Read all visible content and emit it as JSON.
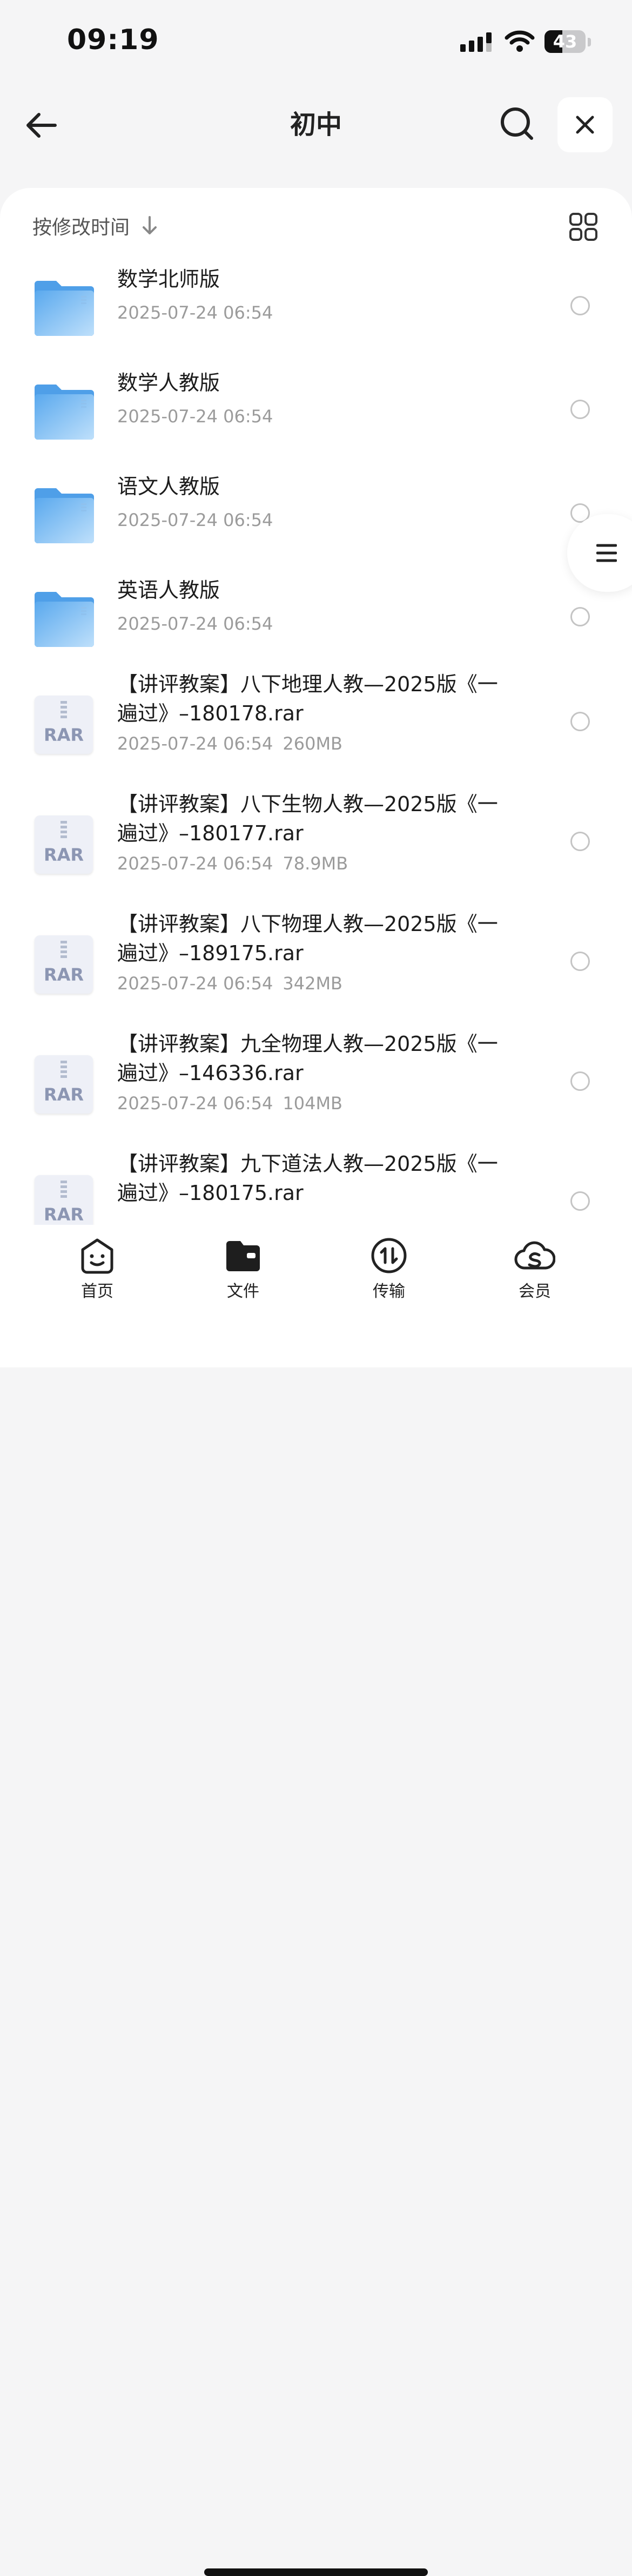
{
  "status_bar": {
    "time": "09:19",
    "battery_level": "43",
    "battery_fraction": 0.43
  },
  "header": {
    "title": "初中",
    "back_icon": "arrow-left-icon",
    "search_icon": "search-icon",
    "close_icon": "close-icon"
  },
  "sort": {
    "label": "按修改时间",
    "direction_icon": "arrow-down-icon",
    "view_toggle_icon": "grid-icon"
  },
  "files": [
    {
      "type": "folder",
      "name": "数学北师版",
      "date": "2025-07-24 06:54",
      "size": ""
    },
    {
      "type": "folder",
      "name": "数学人教版",
      "date": "2025-07-24 06:54",
      "size": ""
    },
    {
      "type": "folder",
      "name": "语文人教版",
      "date": "2025-07-24 06:54",
      "size": ""
    },
    {
      "type": "folder",
      "name": "英语人教版",
      "date": "2025-07-24 06:54",
      "size": ""
    },
    {
      "type": "rar",
      "name": "【讲评教案】八下地理人教—2025版《一遍过》–180178.rar",
      "date": "2025-07-24 06:54",
      "size": "260MB"
    },
    {
      "type": "rar",
      "name": "【讲评教案】八下生物人教—2025版《一遍过》–180177.rar",
      "date": "2025-07-24 06:54",
      "size": "78.9MB"
    },
    {
      "type": "rar",
      "name": "【讲评教案】八下物理人教—2025版《一遍过》–189175.rar",
      "date": "2025-07-24 06:54",
      "size": "342MB"
    },
    {
      "type": "rar",
      "name": "【讲评教案】九全物理人教—2025版《一遍过》–146336.rar",
      "date": "2025-07-24 06:54",
      "size": "104MB"
    },
    {
      "type": "rar",
      "name": "【讲评教案】九下道法人教—2025版《一遍过》–180175.rar",
      "date": "",
      "size": ""
    }
  ],
  "rar_label": "RAR",
  "tabs": [
    {
      "label": "首页",
      "icon": "home-face-icon"
    },
    {
      "label": "文件",
      "icon": "folder-icon"
    },
    {
      "label": "传输",
      "icon": "transfer-icon"
    },
    {
      "label": "会员",
      "icon": "cloud-vip-icon"
    }
  ],
  "colors": {
    "folder": "#5aa9ee",
    "accent_dark": "#111111",
    "meta_text": "#9b9b9b"
  }
}
